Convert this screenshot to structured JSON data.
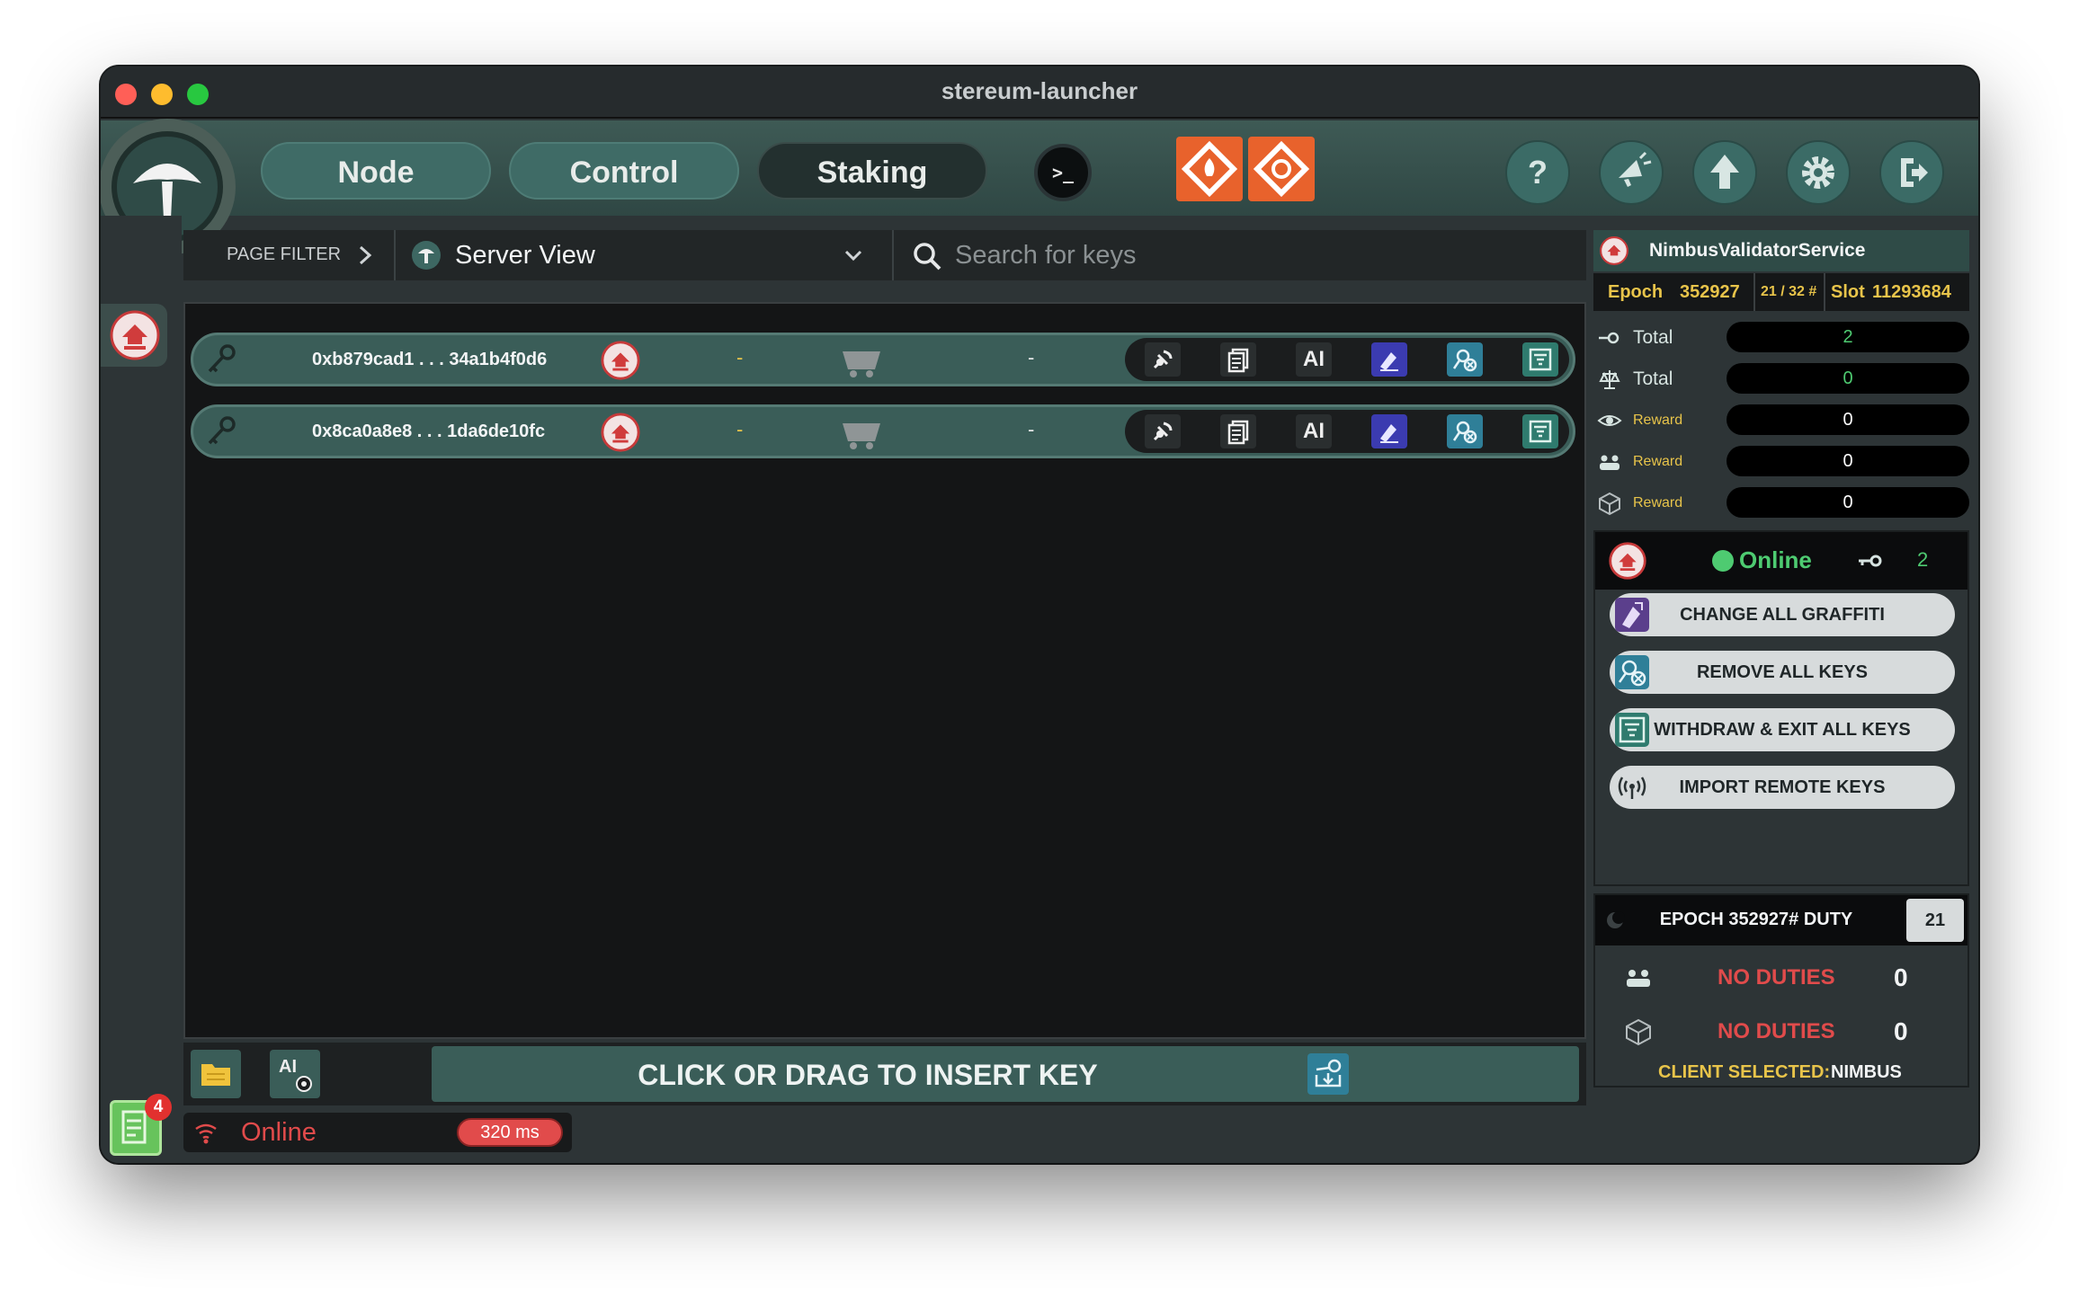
{
  "window": {
    "title": "stereum-launcher"
  },
  "nav": {
    "items": [
      {
        "label": "Node"
      },
      {
        "label": "Control"
      },
      {
        "label": "Staking"
      }
    ],
    "terminal_glyph": ">_",
    "help_glyph": "?"
  },
  "filter": {
    "label": "PAGE FILTER",
    "selected": "Server View",
    "search_placeholder": "Search for keys"
  },
  "keys": [
    {
      "address": "0xb879cad1 . . . 34a1b4f0d6",
      "col1": "-",
      "col2": "-"
    },
    {
      "address": "0x8ca0a8e8 . . . 1da6de10fc",
      "col1": "-",
      "col2": "-"
    }
  ],
  "row_tools": {
    "ai_label": "AI"
  },
  "insert": {
    "label": "CLICK OR DRAG TO INSERT KEY",
    "ai_small": "AI"
  },
  "status": {
    "online": "Online",
    "latency": "320 ms",
    "badge": "4"
  },
  "service": {
    "name": "NimbusValidatorService",
    "epoch_label": "Epoch",
    "epoch": "352927",
    "slots": "21 / 32 #",
    "slot_label": "Slot",
    "slot": "11293684"
  },
  "stats": [
    {
      "icon": "key-icon",
      "label": "Total",
      "value": "2",
      "color": "#4ecb71"
    },
    {
      "icon": "balance-icon",
      "label": "Total",
      "value": "0",
      "color": "#4ecb71"
    },
    {
      "icon": "eye-icon",
      "label": "Reward",
      "value": "0",
      "color": "#ffffff"
    },
    {
      "icon": "group-icon",
      "label": "Reward",
      "value": "0",
      "color": "#ffffff"
    },
    {
      "icon": "cube-icon",
      "label": "Reward",
      "value": "0",
      "color": "#ffffff"
    }
  ],
  "client": {
    "status": "Online",
    "key_count": "2"
  },
  "actions": [
    {
      "label": "CHANGE ALL GRAFFITI",
      "icon_color": "#5b3f8c"
    },
    {
      "label": "REMOVE ALL KEYS",
      "icon_color": "#2f7f98"
    },
    {
      "label": "WITHDRAW & EXIT ALL KEYS",
      "icon_color": "#2f7b6e"
    },
    {
      "label": "IMPORT REMOTE KEYS",
      "icon_color": "#d7dbdc"
    }
  ],
  "duty": {
    "title": "EPOCH 352927# DUTY",
    "count": "21",
    "rows": [
      {
        "label": "NO DUTIES",
        "value": "0"
      },
      {
        "label": "NO DUTIES",
        "value": "0"
      }
    ],
    "client_label": "CLIENT SELECTED:",
    "client_value": "NIMBUS"
  },
  "colors": {
    "accent": "#3a5d58",
    "warning": "#e14b4b",
    "gold": "#e8c44a",
    "green": "#4ecb71"
  }
}
